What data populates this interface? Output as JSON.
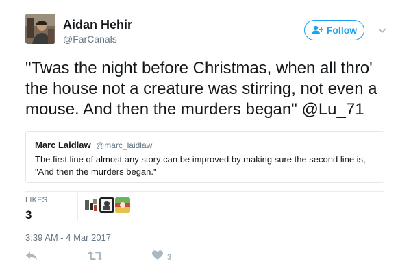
{
  "author": {
    "name": "Aidan Hehir",
    "handle": "@FarCanals"
  },
  "follow_button": {
    "label": "Follow",
    "icon": "person-plus-icon",
    "color": "#1da1f2"
  },
  "menu_icon": "chevron-down-icon",
  "tweet": {
    "lines": [
      "\"Twas the night before Christmas, when all thro'",
      "the house not a creature was stirring, not even a",
      "mouse. And then the murders began\""
    ],
    "mention": "@Lu_71"
  },
  "quoted_tweet": {
    "name": "Marc Laidlaw",
    "handle": "@marc_laidlaw",
    "lines": [
      "The first line of almost any story can be improved by making sure the second line is,",
      "\"And then the murders began.\""
    ]
  },
  "stats": {
    "likes_label": "LIKES",
    "likes_count": "3",
    "likers": [
      "liker-avatar-1",
      "liker-avatar-2",
      "liker-avatar-3"
    ]
  },
  "timestamp": "3:39 AM - 4 Mar 2017",
  "actions": {
    "reply_icon": "reply-icon",
    "retweet_icon": "retweet-icon",
    "like_icon": "heart-icon",
    "like_count": "3"
  },
  "colors": {
    "text": "#14171a",
    "secondary": "#657786",
    "icon": "#aab8c2",
    "border": "#e1e8ed"
  }
}
